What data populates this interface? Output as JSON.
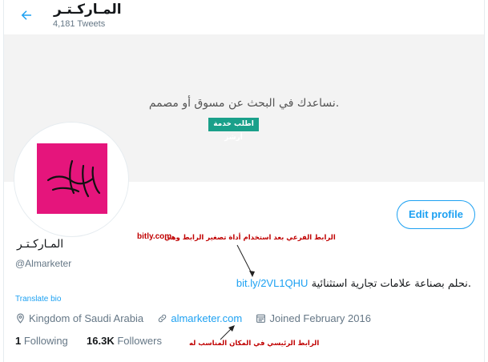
{
  "header": {
    "title": "المـاركـتـر",
    "tweet_count": "4,181 Tweets"
  },
  "banner": {
    "tagline": "نساعدك في البحث عن مسوق أو مصمم.",
    "cta": "اطلب خدمة أرشز"
  },
  "profile": {
    "edit_label": "Edit profile",
    "name": "المـاركـتـر",
    "handle": "@Almarketer",
    "bio_text": "نحلم بصناعة علامات تجارية استثنائية.",
    "bio_link": "bit.ly/2VL1QHU",
    "translate_label": "Translate bio",
    "location": "Kingdom of Saudi Arabia",
    "website": "almarketer.com",
    "joined": "Joined February 2016",
    "following_count": "1",
    "following_label": "Following",
    "followers_count": "16.3K",
    "followers_label": "Followers"
  },
  "annotations": {
    "short_link_note": "الرابط الفرعي بعد استخدام أداة تصغير الرابط وهي",
    "short_link_tool": "bitly.com",
    "main_link_note": "الرابط الرئيسي في المكان المناسب له"
  },
  "colors": {
    "accent": "#1da1f2",
    "banner_button": "#1aa08a",
    "avatar_bg": "#e5157c",
    "annotation": "#c00000"
  },
  "icons": [
    "back-arrow-icon",
    "location-pin-icon",
    "link-icon",
    "calendar-icon"
  ]
}
